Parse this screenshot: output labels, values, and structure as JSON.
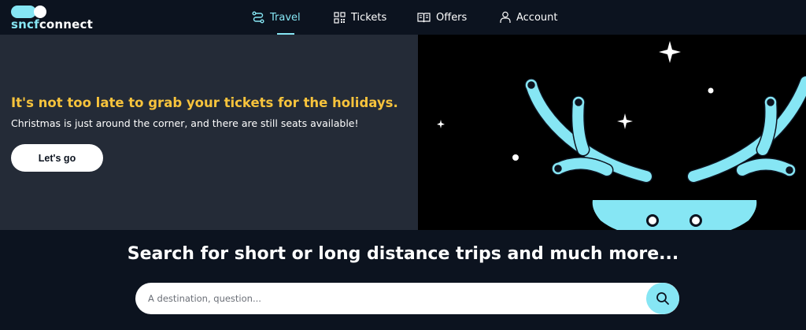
{
  "header": {
    "logo": {
      "part1": "sncf",
      "part2": "connect"
    },
    "nav": [
      {
        "label": "Travel",
        "icon": "route-icon",
        "active": true
      },
      {
        "label": "Tickets",
        "icon": "qr-code-icon",
        "active": false
      },
      {
        "label": "Offers",
        "icon": "book-icon",
        "active": false
      },
      {
        "label": "Account",
        "icon": "user-icon",
        "active": false
      }
    ]
  },
  "hero": {
    "title": "It's not too late to grab your tickets for the holidays.",
    "subtitle": "Christmas is just around the corner, and there are still seats available!",
    "cta_label": "Let's go",
    "illustration": "reindeer-antlers-illustration"
  },
  "search": {
    "title": "Search for short or long distance trips and much more...",
    "placeholder": "A destination, question...",
    "button_icon": "search-icon"
  },
  "colors": {
    "accent": "#86e6f4",
    "headline_yellow": "#f7c33c",
    "background": "#0c131f",
    "hero_panel": "#242b37"
  }
}
